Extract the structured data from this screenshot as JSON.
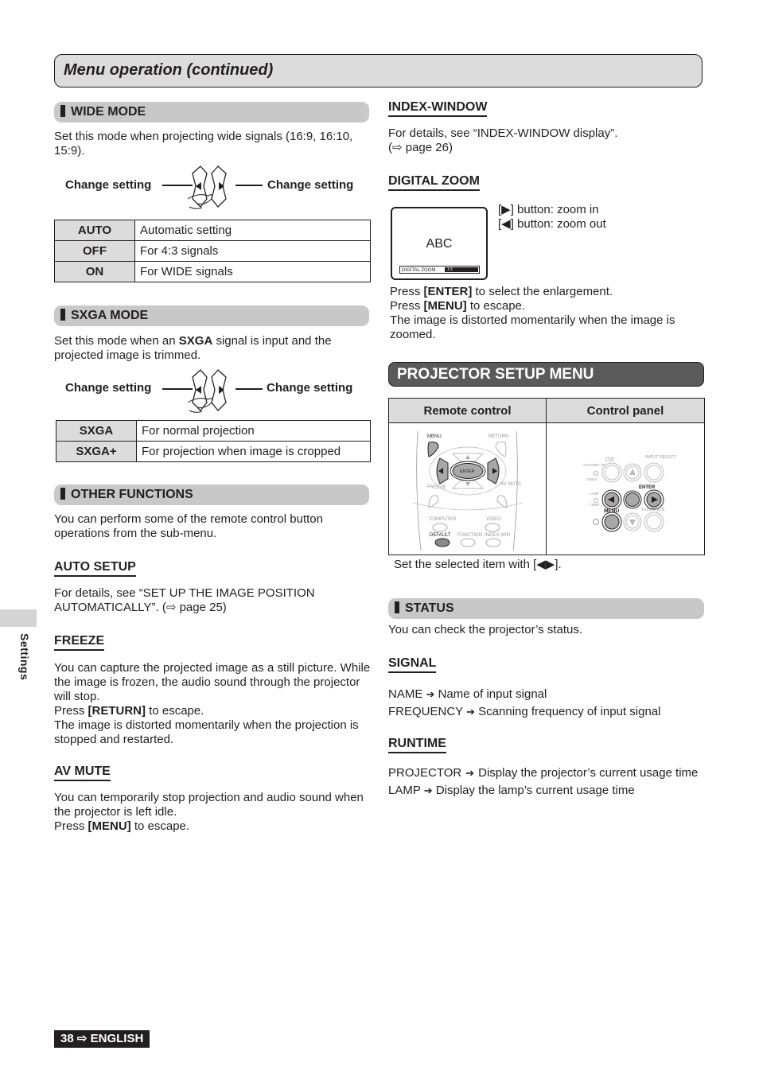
{
  "header": {
    "title": "Menu operation (continued)"
  },
  "side_tab": {
    "label": "Settings"
  },
  "footer": {
    "page_number": "38",
    "arrow": "⇨",
    "language": "ENGLISH"
  },
  "left": {
    "wide_mode": {
      "title": "WIDE MODE",
      "description": "Set this mode when projecting wide signals (16:9, 16:10, 15:9).",
      "change_left": "Change setting",
      "change_right": "Change setting",
      "rows": [
        {
          "key": "AUTO",
          "value": "Automatic setting"
        },
        {
          "key": "OFF",
          "value": "For 4:3 signals"
        },
        {
          "key": "ON",
          "value": "For WIDE signals"
        }
      ]
    },
    "sxga_mode": {
      "title": "SXGA MODE",
      "desc_pre": "Set this mode when an ",
      "desc_bold": "SXGA",
      "desc_post": " signal is input and the projected image is trimmed.",
      "change_left": "Change setting",
      "change_right": "Change setting",
      "rows": [
        {
          "key": "SXGA",
          "value": "For normal projection"
        },
        {
          "key": "SXGA+",
          "value": "For projection when image is cropped"
        }
      ]
    },
    "other_functions": {
      "title": "OTHER FUNCTIONS",
      "description": "You can perform some of the remote control button operations from the sub-menu."
    },
    "auto_setup": {
      "title": "AUTO SETUP",
      "description": "For details, see “SET UP THE IMAGE POSITION AUTOMATICALLY”. (⇨ page 25)"
    },
    "freeze": {
      "title": "FREEZE",
      "line1": "You can capture the projected image as a still picture. While the image is frozen, the audio sound through the projector will stop.",
      "press_pre": "Press ",
      "press_key": "[RETURN]",
      "press_post": " to escape.",
      "line3": "The image is distorted momentarily when the projection is stopped and restarted."
    },
    "av_mute": {
      "title": "AV MUTE",
      "line1": "You can temporarily stop projection and audio sound when the projector is left idle.",
      "press_pre": "Press ",
      "press_key": "[MENU]",
      "press_post": " to escape."
    }
  },
  "right": {
    "index_window": {
      "title": "INDEX-WINDOW",
      "line1": "For details, see “INDEX-WINDOW display”.",
      "line2": "(⇨ page 26)"
    },
    "digital_zoom": {
      "title": "DIGITAL ZOOM",
      "screen_text": "ABC",
      "osd_label": "DIGITAL ZOOM",
      "osd_value": "1.5",
      "zoom_in_key": "[▶]",
      "zoom_in": " button: zoom in",
      "zoom_out_key": "[◀]",
      "zoom_out": " button: zoom out",
      "enter_pre": "Press ",
      "enter_key": "[ENTER]",
      "enter_post": " to select the enlargement.",
      "menu_pre": "Press ",
      "menu_key": "[MENU]",
      "menu_post": " to escape.",
      "note": "The image is distorted momentarily when the image is zoomed."
    },
    "projector_setup": {
      "title": "PROJECTOR SETUP MENU",
      "col_remote": "Remote control",
      "col_panel": "Control panel",
      "remote_labels": {
        "menu": "MENU",
        "return": "RETURN",
        "enter": "ENTER",
        "freeze": "FREEZE",
        "av_mute": "AV MUTE",
        "computer": "COMPUTER",
        "video": "VIDEO",
        "default": "DEFAULT",
        "function": "FUNCTION",
        "index_win": "INDEX-WIN"
      },
      "panel_labels": {
        "power": "⏻/I",
        "input_select": "INPUT SELECT",
        "standby": "STANDBY (R)",
        "on": "ON(G)",
        "enter": "ENTER",
        "lamp": "LAMP",
        "temp": "TEMP",
        "menu": "MENU",
        "function": "FUNCTION"
      },
      "note": "Set the selected item with [◀▶]."
    },
    "status": {
      "title": "STATUS",
      "description": "You can check the projector’s status."
    },
    "signal": {
      "title": "SIGNAL",
      "items": [
        {
          "key": "NAME",
          "value": "Name of input signal"
        },
        {
          "key": "FREQUENCY",
          "value": "Scanning frequency of input signal"
        }
      ]
    },
    "runtime": {
      "title": "RUNTIME",
      "items": [
        {
          "key": "PROJECTOR",
          "value": "Display the projector’s current usage time"
        },
        {
          "key": "LAMP",
          "value": "Display the lamp’s current usage time"
        }
      ]
    }
  }
}
